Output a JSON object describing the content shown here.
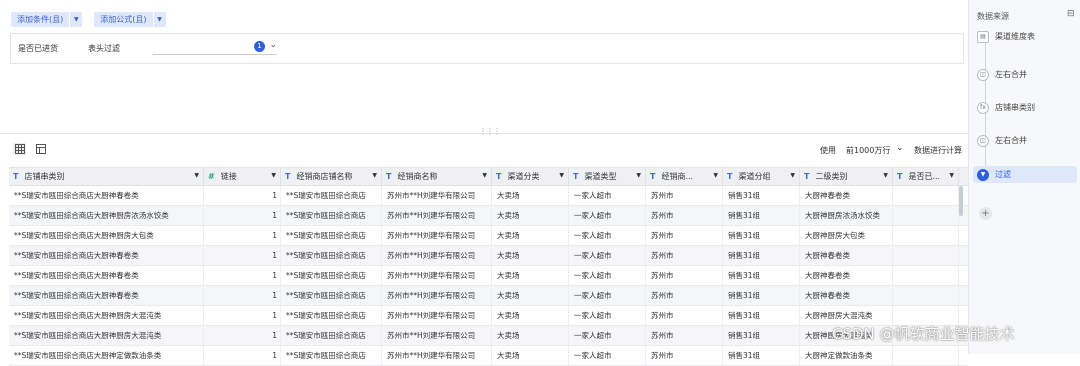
{
  "filter": {
    "add_condition": "添加条件(且)",
    "add_formula": "添加公式(且)",
    "condition": {
      "field": "是否已进货",
      "op": "表头过滤",
      "badge": "1"
    }
  },
  "toolbar": {
    "use_label": "使用",
    "rows_select": "前1000万行",
    "compute": "数据进行计算"
  },
  "table": {
    "headers": [
      {
        "type": "T",
        "label": "店铺串类别"
      },
      {
        "type": "#",
        "label": "链接"
      },
      {
        "type": "T",
        "label": "经销商店铺名称"
      },
      {
        "type": "T",
        "label": "经销商名称"
      },
      {
        "type": "T",
        "label": "渠道分类"
      },
      {
        "type": "T",
        "label": "渠道类型"
      },
      {
        "type": "T",
        "label": "经销商..."
      },
      {
        "type": "T",
        "label": "渠道分组"
      },
      {
        "type": "T",
        "label": "二级类别"
      },
      {
        "type": "T",
        "label": "是否已..."
      }
    ],
    "rows": [
      [
        "**S瑞安市瓯田综合商店大厨神春卷类",
        "1",
        "**S瑞安市瓯田综合商店",
        "苏州市**H刘建华有限公司",
        "大卖场",
        "一家人超市",
        "苏州市",
        "销售31组",
        "大厨神春卷类",
        ""
      ],
      [
        "**S瑞安市瓯田综合商店大厨神厨房浓汤水饺类",
        "1",
        "**S瑞安市瓯田综合商店",
        "苏州市**H刘建华有限公司",
        "大卖场",
        "一家人超市",
        "苏州市",
        "销售31组",
        "大厨神厨房浓汤水饺类",
        ""
      ],
      [
        "**S瑞安市瓯田综合商店大厨神厨房大包类",
        "1",
        "**S瑞安市瓯田综合商店",
        "苏州市**H刘建华有限公司",
        "大卖场",
        "一家人超市",
        "苏州市",
        "销售31组",
        "大厨神厨房大包类",
        ""
      ],
      [
        "**S瑞安市瓯田综合商店大厨神春卷类",
        "1",
        "**S瑞安市瓯田综合商店",
        "苏州市**H刘建华有限公司",
        "大卖场",
        "一家人超市",
        "苏州市",
        "销售31组",
        "大厨神春卷类",
        ""
      ],
      [
        "**S瑞安市瓯田综合商店大厨神春卷类",
        "1",
        "**S瑞安市瓯田综合商店",
        "苏州市**H刘建华有限公司",
        "大卖场",
        "一家人超市",
        "苏州市",
        "销售31组",
        "大厨神春卷类",
        ""
      ],
      [
        "**S瑞安市瓯田综合商店大厨神春卷类",
        "1",
        "**S瑞安市瓯田综合商店",
        "苏州市**H刘建华有限公司",
        "大卖场",
        "一家人超市",
        "苏州市",
        "销售31组",
        "大厨神春卷类",
        ""
      ],
      [
        "**S瑞安市瓯田综合商店大厨神厨房大混沌类",
        "1",
        "**S瑞安市瓯田综合商店",
        "苏州市**H刘建华有限公司",
        "大卖场",
        "一家人超市",
        "苏州市",
        "销售31组",
        "大厨神厨房大混沌类",
        ""
      ],
      [
        "**S瑞安市瓯田综合商店大厨神厨房大混沌类",
        "1",
        "**S瑞安市瓯田综合商店",
        "苏州市**H刘建华有限公司",
        "大卖场",
        "一家人超市",
        "苏州市",
        "销售31组",
        "大厨神厨房大混沌类",
        ""
      ],
      [
        "**S瑞安市瓯田综合商店大厨神定做款油条类",
        "1",
        "**S瑞安市瓯田综合商店",
        "苏州市**H刘建华有限公司",
        "大卖场",
        "一家人超市",
        "苏州市",
        "销售31组",
        "大厨神定做款油条类",
        ""
      ]
    ]
  },
  "side": {
    "title": "数据来源",
    "nodes": [
      {
        "icon": "▤",
        "label": "渠道维度表"
      },
      {
        "icon": "◫",
        "label": "左右合并"
      },
      {
        "icon": "fx",
        "label": "店铺串类别"
      },
      {
        "icon": "◫",
        "label": "左右合并"
      },
      {
        "icon": "▼",
        "label": "过滤"
      }
    ]
  },
  "watermark": "CSDN @帆软商业智能技术"
}
